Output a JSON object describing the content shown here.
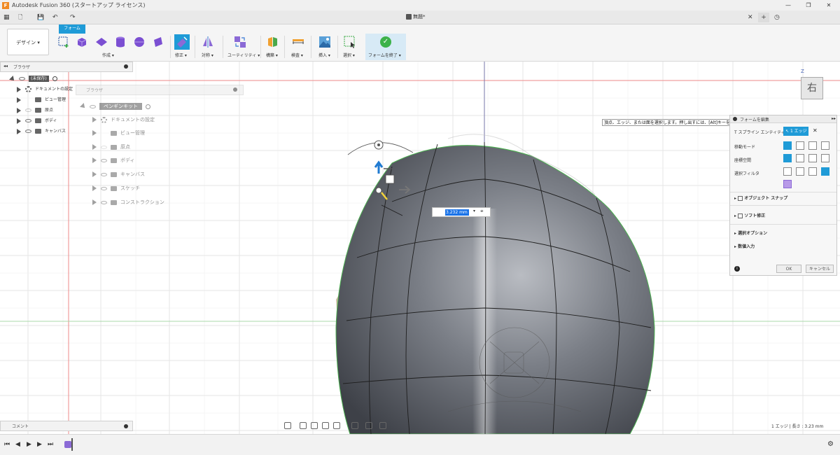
{
  "window": {
    "app_icon": "F",
    "title": "Autodesk Fusion 360 (スタートアップ ライセンス)",
    "minimize": "—",
    "restore": "❐",
    "close": "✕"
  },
  "quickbar": {
    "grid_icon": "▦",
    "file_icon": "🗋",
    "save_icon": "💾",
    "undo_icon": "↶",
    "redo_icon": "↷",
    "document_title": "無題*",
    "tab_close": "✕",
    "new_tab": "+",
    "clock_icon": "◷"
  },
  "ribbon": {
    "workspace": "デザイン ▾",
    "active_tab": "フォーム",
    "groups": [
      {
        "label": "作成 ▾"
      },
      {
        "label": "修正 ▾"
      },
      {
        "label": "対称 ▾"
      },
      {
        "label": "ユーティリティ ▾"
      },
      {
        "label": "構築 ▾"
      },
      {
        "label": "検査 ▾"
      },
      {
        "label": "挿入 ▾"
      },
      {
        "label": "選択 ▾"
      }
    ],
    "finish_form": "フォームを終了 ▾"
  },
  "browser": {
    "header": "ブラウザ",
    "root": "(未保存)",
    "items": [
      {
        "label": "ドキュメントの設定"
      },
      {
        "label": "ビュー管理"
      },
      {
        "label": "原点"
      },
      {
        "label": "ボディ"
      },
      {
        "label": "キャンバス"
      }
    ]
  },
  "ghost_browser": {
    "header": "ブラウザ",
    "root": "ペンギンキット",
    "items": [
      {
        "label": "ドキュメントの設定"
      },
      {
        "label": "ビュー管理"
      },
      {
        "label": "原点"
      },
      {
        "label": "ボディ"
      },
      {
        "label": "キャンバス"
      },
      {
        "label": "スケッチ"
      },
      {
        "label": "コンストラクション"
      }
    ]
  },
  "tooltip": "頂点、エッジ、または面を選択します。押し出すには、[Alt]キーを押します。",
  "edit_form": {
    "title": "フォームを編集",
    "tspline_entity_label": "T スプライン エンティティ",
    "tspline_entity_value": "1 エッジ",
    "transform_mode": "移動モード",
    "coordinate_space": "座標空間",
    "selection_filter": "選択フィルタ",
    "object_snap": "オブジェクト スナップ",
    "soft_modify": "ソフト修正",
    "selection_options": "選択オプション",
    "numeric_input": "数値入力",
    "ok": "OK",
    "cancel": "キャンセル"
  },
  "manipulator": {
    "value": "3.232 mm"
  },
  "comments": {
    "label": "コメント"
  },
  "status": "1 エッジ | 長さ : 3.23 mm",
  "viewcube": {
    "face": "右",
    "axis": "Z"
  }
}
